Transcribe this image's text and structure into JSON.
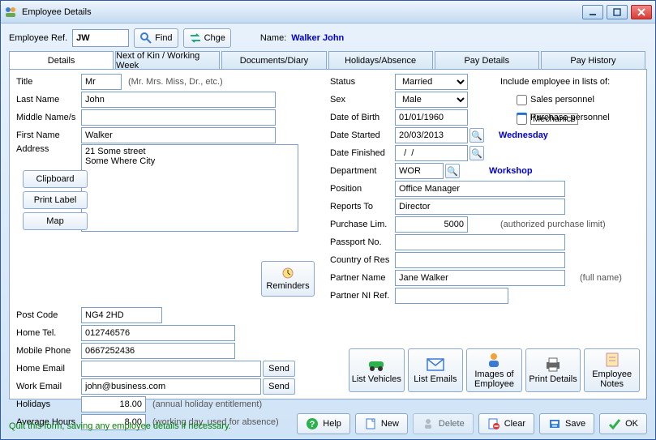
{
  "window": {
    "title": "Employee Details"
  },
  "toprow": {
    "ref_label": "Employee Ref.",
    "ref_value": "JW",
    "find": "Find",
    "chge": "Chge",
    "name_label": "Name:",
    "name_value": "Walker  John"
  },
  "tabs": [
    "Details",
    "Next of Kin / Working Week",
    "Documents/Diary",
    "Holidays/Absence",
    "Pay Details",
    "Pay History"
  ],
  "left": {
    "title_lbl": "Title",
    "title_val": "Mr",
    "title_hint": "(Mr. Mrs. Miss, Dr., etc.)",
    "lastname_lbl": "Last Name",
    "lastname_val": "John",
    "middle_lbl": "Middle Name/s",
    "middle_val": "",
    "firstname_lbl": "First Name",
    "firstname_val": "Walker",
    "address_lbl": "Address",
    "address_val": "21 Some street\nSome Where City",
    "clipboard": "Clipboard",
    "printlabel": "Print Label",
    "map": "Map",
    "postcode_lbl": "Post Code",
    "postcode_val": "NG4 2HD",
    "hometel_lbl": "Home Tel.",
    "hometel_val": "012746576",
    "mobile_lbl": "Mobile Phone",
    "mobile_val": "0667252436",
    "homeemail_lbl": "Home Email",
    "homeemail_val": "",
    "workemail_lbl": "Work Email",
    "workemail_val": "john@business.com",
    "send": "Send",
    "holidays_lbl": "Holidays",
    "holidays_val": "18.00",
    "holidays_hint": "(annual holiday entitlement)",
    "avghours_lbl": "Average Hours",
    "avghours_val": "8.00",
    "avghours_hint": "(working day, used for absence)",
    "reminders": "Reminders"
  },
  "right": {
    "status_lbl": "Status",
    "status_val": "Married",
    "sex_lbl": "Sex",
    "sex_val": "Male",
    "dob_lbl": "Date of Birth",
    "dob_val": "01/01/1960",
    "started_lbl": "Date Started",
    "started_val": "20/03/2013",
    "started_day": "Wednesday",
    "finished_lbl": "Date Finished",
    "finished_val": "  /  /",
    "dept_lbl": "Department",
    "dept_val": "WOR",
    "dept_name": "Workshop",
    "position_lbl": "Position",
    "position_val": "Office Manager",
    "reports_lbl": "Reports To",
    "reports_val": "Director",
    "purchlim_lbl": "Purchase Lim.",
    "purchlim_val": "5000",
    "purchlim_hint": "(authorized purchase limit)",
    "passport_lbl": "Passport No.",
    "passport_val": "",
    "country_lbl": "Country of Res",
    "country_val": "",
    "partner_lbl": "Partner Name",
    "partner_val": "Jane Walker",
    "partner_hint": "(full name)",
    "partnerni_lbl": "Partner NI Ref.",
    "partnerni_val": "",
    "include_lbl": "Include employee in lists of:",
    "chk_sales": "Sales personnel",
    "chk_purchase": "Purchase personnel",
    "chk_mechanics": "Mechanics"
  },
  "actions": {
    "list_vehicles": "List Vehicles",
    "list_emails": "List Emails",
    "images": "Images of\nEmployee",
    "print_details": "Print Details",
    "notes": "Employee\nNotes"
  },
  "status_bar": "Quit this form, saving any employee details if necessary.",
  "bottom": {
    "help": "Help",
    "new": "New",
    "delete": "Delete",
    "clear": "Clear",
    "save": "Save",
    "ok": "OK"
  }
}
